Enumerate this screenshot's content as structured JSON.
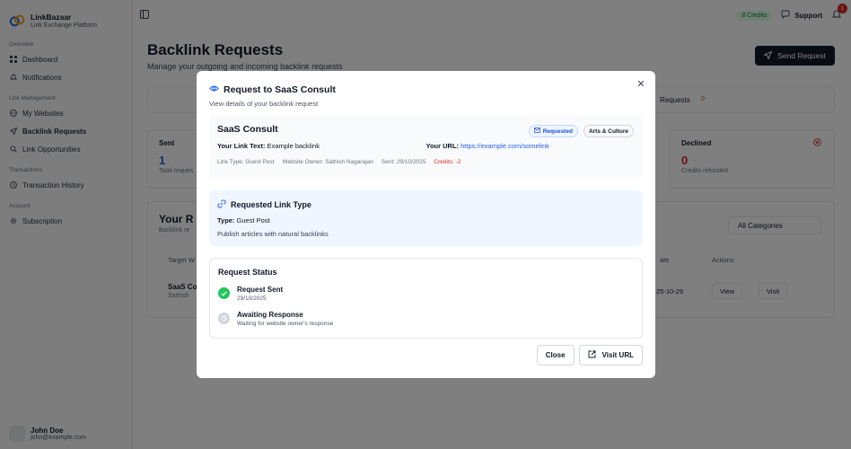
{
  "brand": {
    "name": "LinkBazaar",
    "tagline": "Link Exchange Platform"
  },
  "sidebar": {
    "groups": [
      {
        "label": "Overview",
        "items": [
          {
            "label": "Dashboard",
            "icon": "grid-icon"
          },
          {
            "label": "Notifications",
            "icon": "bell-icon"
          }
        ]
      },
      {
        "label": "Link Management",
        "items": [
          {
            "label": "My Websites",
            "icon": "globe-icon"
          },
          {
            "label": "Backlink Requests",
            "icon": "send-icon"
          },
          {
            "label": "Link Opportunities",
            "icon": "search-icon"
          }
        ]
      },
      {
        "label": "Transactions",
        "items": [
          {
            "label": "Transaction History",
            "icon": "history-icon"
          }
        ]
      },
      {
        "label": "Account",
        "items": [
          {
            "label": "Subscription",
            "icon": "gear-icon"
          }
        ]
      }
    ],
    "active": "Backlink Requests",
    "user": {
      "name": "John Doe",
      "email": "john@example.com"
    }
  },
  "topbar": {
    "credits": "8 Credits",
    "support": "Support",
    "notification_count": "1"
  },
  "page": {
    "title": "Backlink Requests",
    "subtitle": "Manage your outgoing and incoming backlink requests",
    "send_button": "Send Request",
    "tabs_partial": "Requests",
    "tabs_count": "0",
    "stats": {
      "sent": {
        "label": "Sent",
        "value": "1",
        "caption": "Total reques"
      },
      "declined": {
        "label": "Declined",
        "value": "0",
        "caption": "Credits refunded"
      }
    },
    "section_title": "Your R",
    "section_sub": "Backlink re",
    "filter": "All Categories",
    "table": {
      "col_target": "Target W",
      "col_date": "ate",
      "col_actions": "Actions",
      "row": {
        "site": "SaaS Co",
        "owner": "Sathish",
        "date": "25-10-29",
        "view": "View",
        "visit": "Visit"
      }
    }
  },
  "modal": {
    "title": "Request to SaaS Consult",
    "subtitle": "View details of your backlink request",
    "site_name": "SaaS Consult",
    "status_badge": "Requested",
    "category_badge": "Arts & Culture",
    "link_text_label": "Your Link Text:",
    "link_text_value": "Example backlink",
    "url_label": "Your URL:",
    "url_value": "https://example.com/somelink",
    "link_type": "Link Type: Guest Post",
    "owner": "Website Owner: Sathish Nagarajan",
    "sent": "Sent: 29/10/2025",
    "credits": "Credits: -2",
    "requested_type_title": "Requested Link Type",
    "type_label": "Type:",
    "type_value": "Guest Post",
    "type_desc": "Publish articles with natural backlinks",
    "status_title": "Request Status",
    "steps": [
      {
        "label": "Request Sent",
        "detail": "29/10/2025",
        "state": "done"
      },
      {
        "label": "Awaiting Response",
        "detail": "Waiting for website owner's response",
        "state": "pending"
      }
    ],
    "close_button": "Close",
    "visit_button": "Visit URL"
  },
  "colors": {
    "accent": "#2563eb",
    "success": "#22c55e",
    "danger": "#dc2626",
    "overlay": "rgba(0,0,0,0.5)"
  }
}
